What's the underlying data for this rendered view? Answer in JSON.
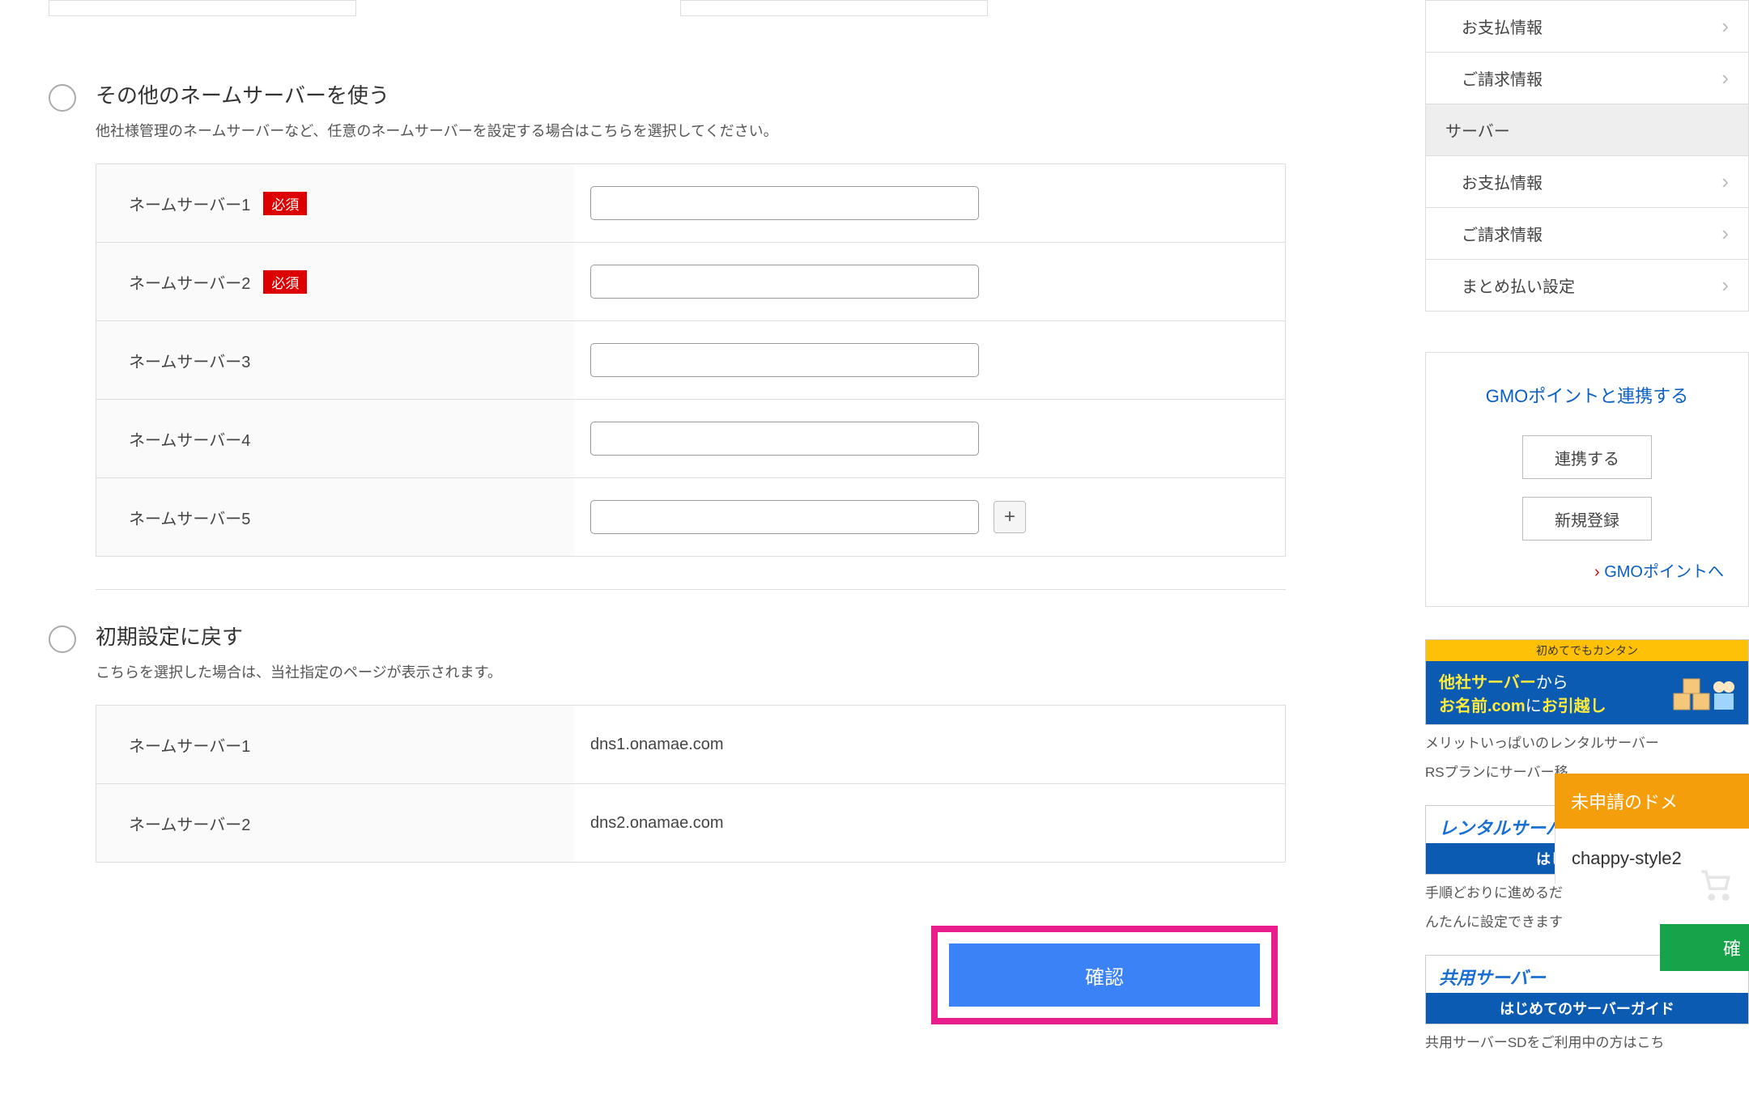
{
  "main": {
    "other_ns": {
      "title": "その他のネームサーバーを使う",
      "desc": "他社様管理のネームサーバーなど、任意のネームサーバーを設定する場合はこちらを選択してください。",
      "rows": [
        {
          "label": "ネームサーバー1",
          "required": true,
          "value": ""
        },
        {
          "label": "ネームサーバー2",
          "required": true,
          "value": ""
        },
        {
          "label": "ネームサーバー3",
          "required": false,
          "value": ""
        },
        {
          "label": "ネームサーバー4",
          "required": false,
          "value": ""
        },
        {
          "label": "ネームサーバー5",
          "required": false,
          "value": ""
        }
      ],
      "required_label": "必須"
    },
    "reset_ns": {
      "title": "初期設定に戻す",
      "desc": "こちらを選択した場合は、当社指定のページが表示されます。",
      "rows": [
        {
          "label": "ネームサーバー1",
          "value": "dns1.onamae.com"
        },
        {
          "label": "ネームサーバー2",
          "value": "dns2.onamae.com"
        }
      ]
    },
    "confirm_label": "確認"
  },
  "sidebar": {
    "items": [
      {
        "label": "お支払情報",
        "type": "link"
      },
      {
        "label": "ご請求情報",
        "type": "link"
      },
      {
        "label": "サーバー",
        "type": "header"
      },
      {
        "label": "お支払情報",
        "type": "link"
      },
      {
        "label": "ご請求情報",
        "type": "link"
      },
      {
        "label": "まとめ払い設定",
        "type": "link"
      }
    ],
    "gmo": {
      "title": "GMOポイントと連携する",
      "link_btn": "連携する",
      "reg_btn": "新規登録",
      "to_gmo": "GMOポイントへ"
    },
    "banner1": {
      "top": "初めてでもカンタン",
      "line1a": "他社サーバー",
      "line1b": "から",
      "line2a": "お名前.com",
      "line2b": "に",
      "line2c": "お引越し",
      "caption1": "メリットいっぱいのレンタルサーバー",
      "caption2": "RSプランにサーバー移"
    },
    "banner2": {
      "top": "レンタルサーバ",
      "bot": "はじめてのサー",
      "caption1": "手順どおりに進めるだ",
      "caption2": "んたんに設定できます"
    },
    "banner3": {
      "top": "共用サーバー",
      "bot": "はじめてのサーバーガイド",
      "caption": "共用サーバーSDをご利用中の方はこち"
    }
  },
  "float": {
    "orange": "未申請のドメ",
    "white": "chappy-style2",
    "green": "確"
  }
}
